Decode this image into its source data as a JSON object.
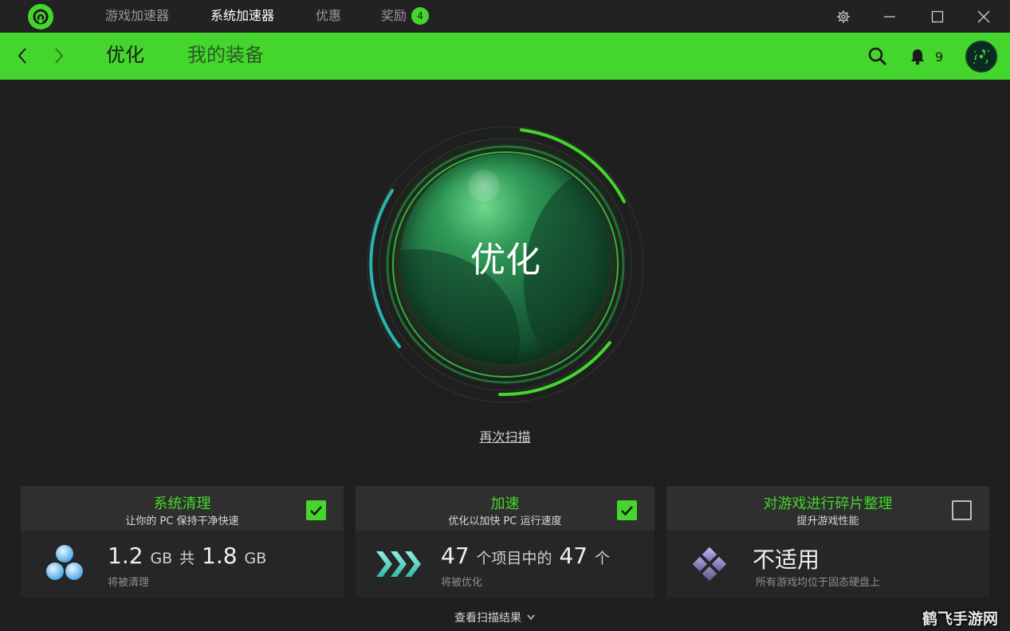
{
  "titlebar": {
    "tabs": [
      {
        "label": "游戏加速器"
      },
      {
        "label": "系统加速器"
      },
      {
        "label": "优惠"
      },
      {
        "label": "奖励",
        "badge": "4"
      }
    ],
    "active_tab": "系统加速器"
  },
  "navbar": {
    "tabs": [
      {
        "label": "优化"
      },
      {
        "label": "我的装备"
      }
    ],
    "notification_count": "9"
  },
  "gauge": {
    "label": "优化"
  },
  "rescan_label": "再次扫描",
  "cards": [
    {
      "title": "系统清理",
      "subtitle": "让你的 PC 保持干净快速",
      "checked": true,
      "value_a": "1.2",
      "unit_a": "GB",
      "connector": "共",
      "value_b": "1.8",
      "unit_b": "GB",
      "caption": "将被清理",
      "icon": "bubbles-icon"
    },
    {
      "title": "加速",
      "subtitle": "优化以加快 PC 运行速度",
      "checked": true,
      "value_a": "47",
      "middle": "个项目中的",
      "value_b": "47",
      "unit_b": "个",
      "caption": "将被优化",
      "icon": "chevrons-icon"
    },
    {
      "title": "对游戏进行碎片整理",
      "subtitle": "提升游戏性能",
      "checked": false,
      "status": "不适用",
      "caption": "所有游戏均位于固态硬盘上",
      "icon": "diamond-tiles-icon"
    }
  ],
  "view_results_label": "查看扫描结果",
  "watermark": "鹤飞手游网",
  "colors": {
    "accent": "#44d62c",
    "background": "#1f1f1f",
    "card_head": "#2f2f2f",
    "card_body": "#262626"
  }
}
